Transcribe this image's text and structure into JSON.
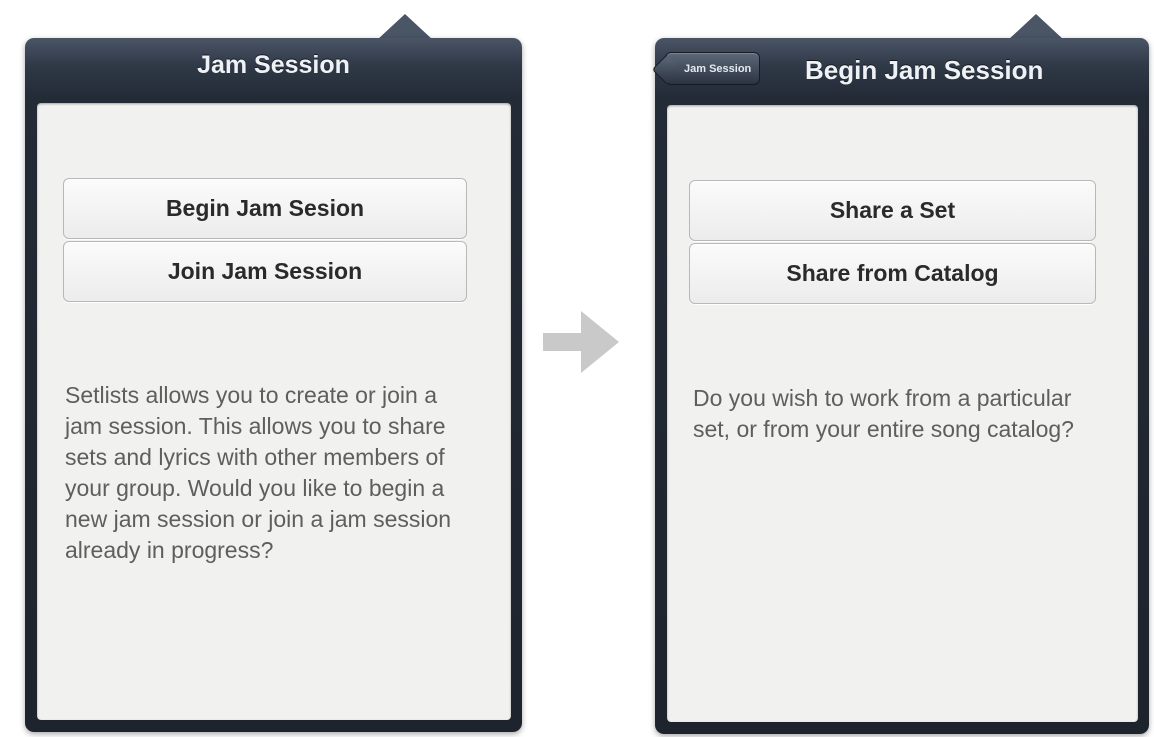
{
  "left_popover": {
    "title": "Jam Session",
    "buttons": {
      "begin_label": "Begin Jam Sesion",
      "join_label": "Join Jam Session"
    },
    "description": "Setlists allows you to create or join a jam session. This allows you to share sets and lyrics with other members of your group. Would you like to begin a new jam session or join a jam session already in progress?"
  },
  "right_popover": {
    "back_label": "Jam Session",
    "title": "Begin Jam Session",
    "buttons": {
      "share_set_label": "Share a Set",
      "share_catalog_label": "Share from Catalog"
    },
    "description": "Do you wish to work from a particular set, or from your entire song catalog?"
  },
  "colors": {
    "nav_bar": "#2f3947",
    "content_bg": "#f1f1f0",
    "flow_arrow": "#c9c9c9"
  },
  "icons": {
    "flow_arrow": "right-arrow-icon"
  }
}
